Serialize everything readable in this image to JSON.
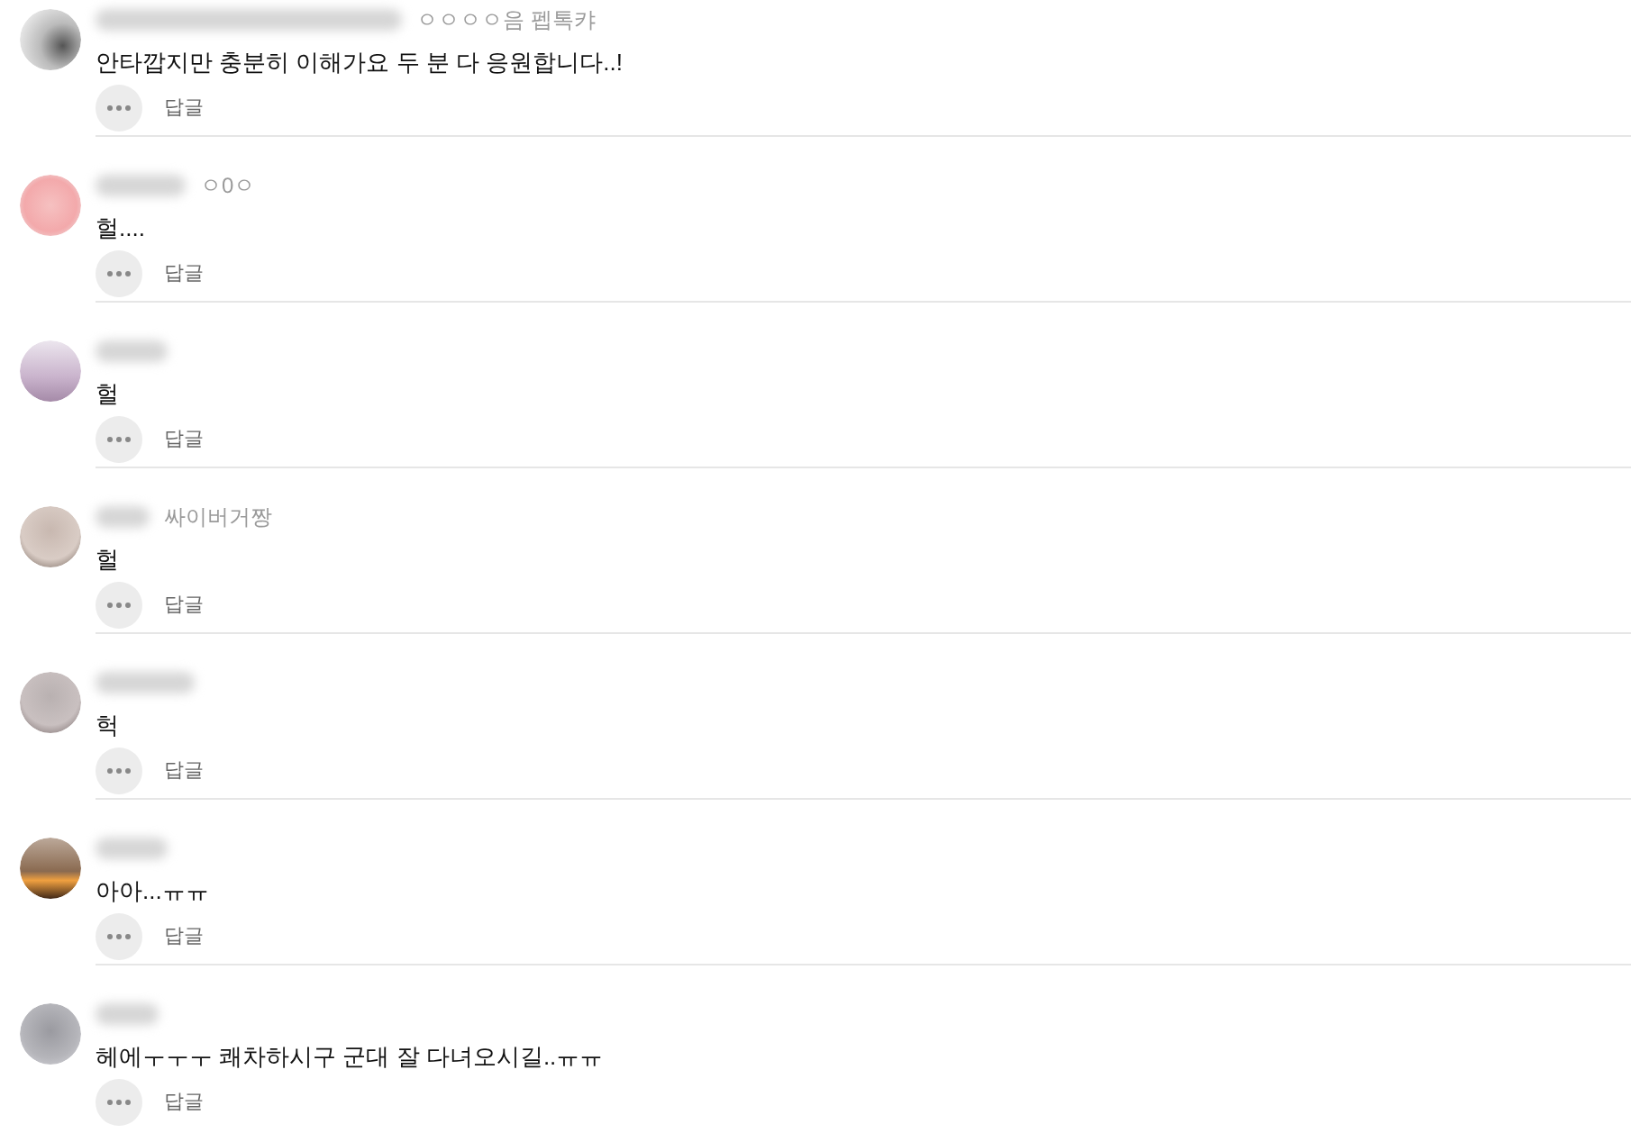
{
  "comments": [
    {
      "tag": "ㅇㅇㅇㅇ음 펩톡캬",
      "body": "안타깝지만 충분히 이해가요 두 분 다 응원합니다..!",
      "reply": "답글"
    },
    {
      "tag": "ㅇ0ㅇ",
      "body": "헐....",
      "reply": "답글"
    },
    {
      "body": "헐",
      "reply": "답글"
    },
    {
      "tag": "싸이버거짱",
      "body": "헐",
      "reply": "답글"
    },
    {
      "body": "헉",
      "reply": "답글"
    },
    {
      "body": "아아...ㅠㅠ",
      "reply": "답글"
    },
    {
      "body": "헤에ㅜㅜㅜ 쾌차하시구 군대 잘 다녀오시길..ㅠㅠ",
      "reply": "답글"
    }
  ]
}
